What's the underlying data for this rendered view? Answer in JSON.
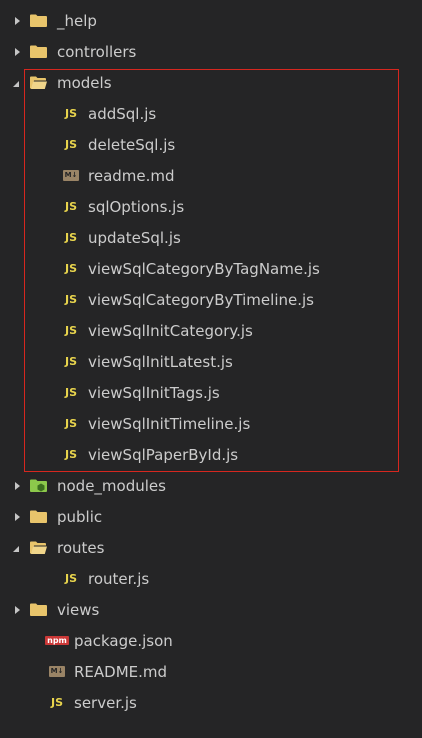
{
  "tree": [
    {
      "type": "folder",
      "label": "_help",
      "expanded": false,
      "icon": "folder-icon"
    },
    {
      "type": "folder",
      "label": "controllers",
      "expanded": false,
      "icon": "folder-icon"
    },
    {
      "type": "folder",
      "label": "models",
      "expanded": true,
      "icon": "folder-open-icon",
      "children": [
        {
          "label": "addSql.js",
          "icon": "js-file-icon"
        },
        {
          "label": "deleteSql.js",
          "icon": "js-file-icon"
        },
        {
          "label": "readme.md",
          "icon": "markdown-file-icon"
        },
        {
          "label": "sqlOptions.js",
          "icon": "js-file-icon"
        },
        {
          "label": "updateSql.js",
          "icon": "js-file-icon"
        },
        {
          "label": "viewSqlCategoryByTagName.js",
          "icon": "js-file-icon"
        },
        {
          "label": "viewSqlCategoryByTimeline.js",
          "icon": "js-file-icon"
        },
        {
          "label": "viewSqlInitCategory.js",
          "icon": "js-file-icon"
        },
        {
          "label": "viewSqlInitLatest.js",
          "icon": "js-file-icon"
        },
        {
          "label": "viewSqlInitTags.js",
          "icon": "js-file-icon"
        },
        {
          "label": "viewSqlInitTimeline.js",
          "icon": "js-file-icon"
        },
        {
          "label": "viewSqlPaperById.js",
          "icon": "js-file-icon"
        }
      ]
    },
    {
      "type": "folder",
      "label": "node_modules",
      "expanded": false,
      "icon": "node-folder-icon"
    },
    {
      "type": "folder",
      "label": "public",
      "expanded": false,
      "icon": "folder-icon"
    },
    {
      "type": "folder",
      "label": "routes",
      "expanded": true,
      "icon": "folder-open-icon",
      "children": [
        {
          "label": "router.js",
          "icon": "js-file-icon"
        }
      ]
    },
    {
      "type": "folder",
      "label": "views",
      "expanded": false,
      "icon": "folder-icon"
    },
    {
      "type": "file",
      "label": "package.json",
      "icon": "npm-file-icon"
    },
    {
      "type": "file",
      "label": "README.md",
      "icon": "markdown-file-icon"
    },
    {
      "type": "file",
      "label": "server.js",
      "icon": "js-file-icon"
    }
  ],
  "icon_text": {
    "js": "JS",
    "md": "M↓",
    "npm": "npm"
  },
  "colors": {
    "background": "#252526",
    "text": "#cccccc",
    "folder": "#e8c46b",
    "js": "#e8d44d",
    "markdown": "#9a8466",
    "npm": "#cb3837",
    "node_modules": "#8cc84b",
    "highlight_border": "#d6271f"
  }
}
